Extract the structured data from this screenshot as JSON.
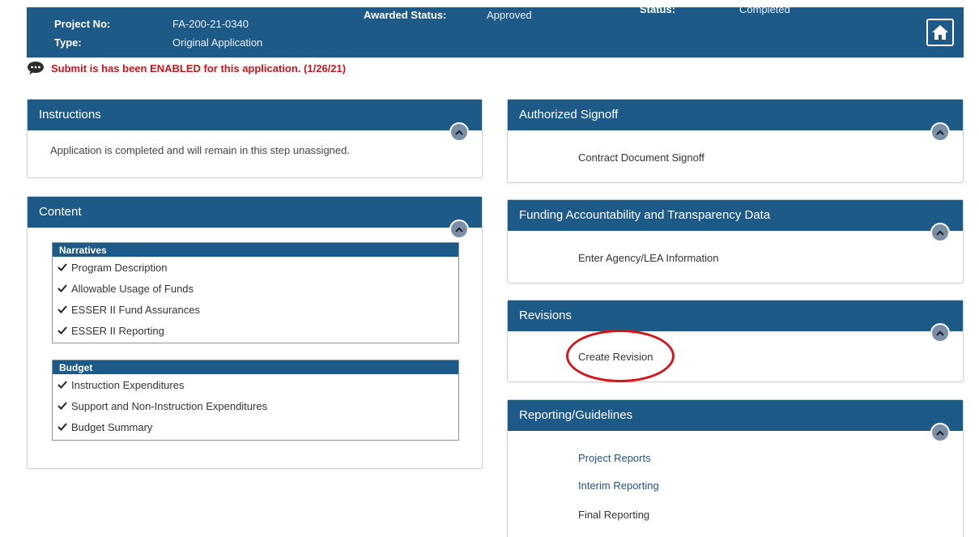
{
  "header": {
    "project_no_label": "Project No:",
    "project_no_value": "FA-200-21-0340",
    "type_label": "Type:",
    "type_value": "Original Application",
    "awarded_status_label": "Awarded Status:",
    "awarded_status_value": "Approved",
    "status_label": "Status:",
    "status_value": "Completed",
    "home_icon": "home-icon"
  },
  "notice": {
    "text": "Submit is has been ENABLED for this application. (1/26/21)",
    "icon": "chat-bubble-icon"
  },
  "instructions": {
    "title": "Instructions",
    "text": "Application is completed and will remain in this step unassigned."
  },
  "content": {
    "title": "Content",
    "narratives": {
      "title": "Narratives",
      "items": [
        "Program Description",
        "Allowable Usage of Funds",
        "ESSER II Fund Assurances",
        "ESSER II Reporting"
      ]
    },
    "budget": {
      "title": "Budget",
      "items": [
        "Instruction Expenditures",
        "Support and Non-Instruction Expenditures",
        "Budget Summary"
      ]
    }
  },
  "authorized_signoff": {
    "title": "Authorized Signoff",
    "items": [
      "Contract Document Signoff"
    ]
  },
  "funding": {
    "title": "Funding Accountability and Transparency Data",
    "items": [
      "Enter Agency/LEA Information"
    ]
  },
  "revisions": {
    "title": "Revisions",
    "items": [
      "Create Revision"
    ]
  },
  "reporting": {
    "title": "Reporting/Guidelines",
    "items": [
      "Project Reports",
      "Interim Reporting",
      "Final Reporting"
    ]
  },
  "colors": {
    "header_blue": "#1e5a87",
    "notice_red": "#c0181e",
    "highlight_red": "#d6141c"
  }
}
